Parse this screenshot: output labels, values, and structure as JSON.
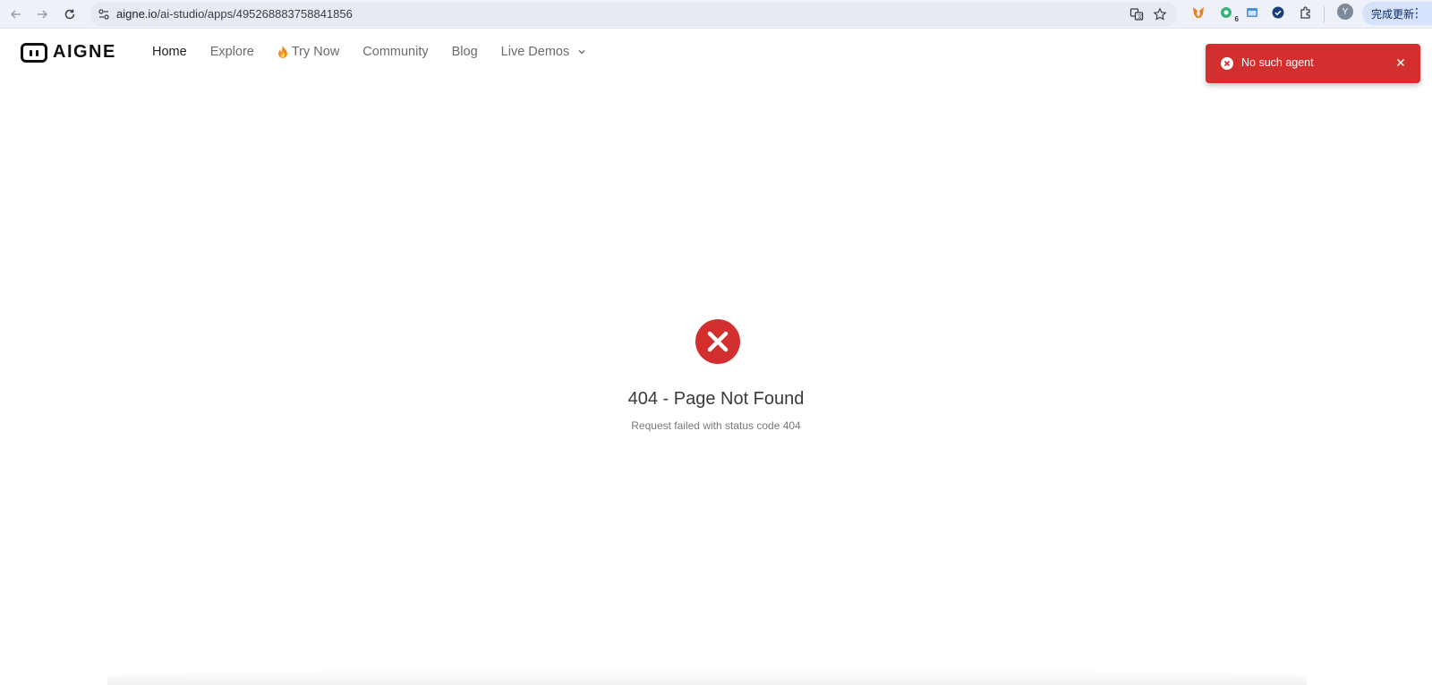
{
  "browser": {
    "url_host": "aigne.io",
    "url_path": "/ai-studio/apps/495268883758841856",
    "profile_initial": "Y",
    "update_label": "完成更新",
    "extension_badge": "6"
  },
  "header": {
    "logo_text": "AIGNE",
    "nav": [
      {
        "label": "Home"
      },
      {
        "label": "Explore"
      },
      {
        "label": "Try Now"
      },
      {
        "label": "Community"
      },
      {
        "label": "Blog"
      },
      {
        "label": "Live Demos"
      }
    ]
  },
  "toast": {
    "message": "No such agent",
    "color": "#d32f2f"
  },
  "error": {
    "title": "404 - Page Not Found",
    "subtitle": "Request failed with status code 404",
    "color": "#d32f2f"
  }
}
